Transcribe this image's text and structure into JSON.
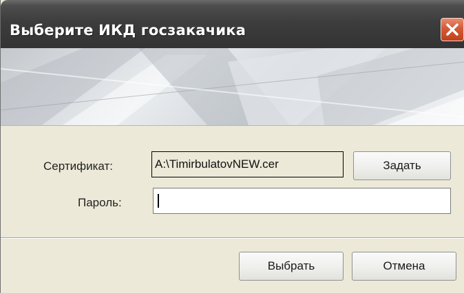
{
  "window": {
    "title": "Выберите ИКД госзакачика",
    "close_icon": "close-icon"
  },
  "form": {
    "certificate_label": "Сертификат:",
    "certificate_value": "A:\\TimirbulatovNEW.cer",
    "set_button": "Задать",
    "password_label": "Пароль:",
    "password_value": ""
  },
  "footer": {
    "select_button": "Выбрать",
    "cancel_button": "Отмена"
  },
  "colors": {
    "titlebar": "#3d3d3d",
    "close_button": "#d45a35",
    "dialog_background": "#ece9d8"
  }
}
